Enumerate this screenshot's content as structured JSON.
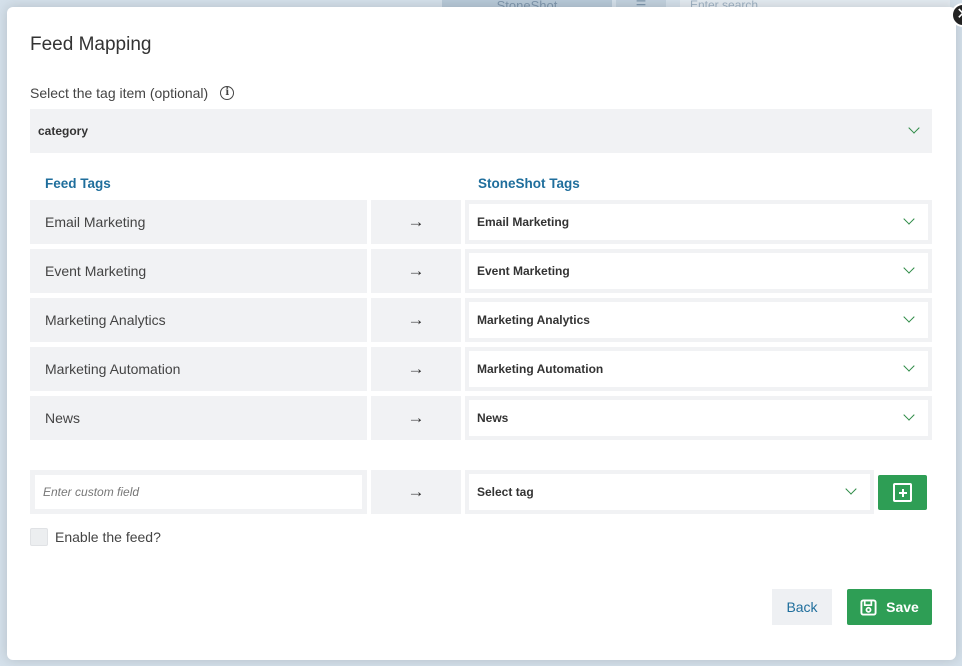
{
  "background": {
    "tab_label": "StoneShot",
    "search_placeholder": "Enter search"
  },
  "modal": {
    "title": "Feed Mapping",
    "tag_item_label": "Select the tag item (optional)",
    "tag_item_value": "category",
    "columns": {
      "feed_tags": "Feed Tags",
      "stoneshot_tags": "StoneShot Tags"
    },
    "arrow": "→",
    "rows": [
      {
        "feed_tag": "Email Marketing",
        "stoneshot_tag": "Email Marketing"
      },
      {
        "feed_tag": "Event Marketing",
        "stoneshot_tag": "Event Marketing"
      },
      {
        "feed_tag": "Marketing Analytics",
        "stoneshot_tag": "Marketing Analytics"
      },
      {
        "feed_tag": "Marketing Automation",
        "stoneshot_tag": "Marketing Automation"
      },
      {
        "feed_tag": "News",
        "stoneshot_tag": "News"
      }
    ],
    "custom_field_placeholder": "Enter custom field",
    "select_tag_placeholder": "Select tag",
    "enable_feed_label": "Enable the feed?",
    "enable_feed_checked": false,
    "back_label": "Back",
    "save_label": "Save"
  },
  "colors": {
    "accent_green": "#2e9e55",
    "heading_blue": "#1f6e9c"
  }
}
